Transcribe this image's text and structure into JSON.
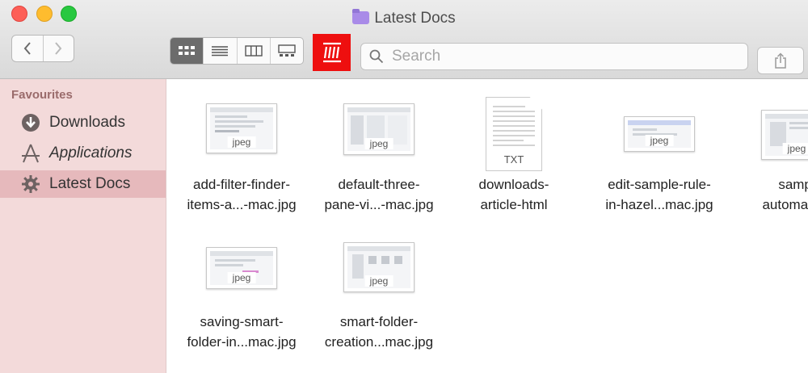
{
  "window": {
    "title": "Latest Docs"
  },
  "toolbar": {
    "search_placeholder": "Search",
    "back_icon": "chevron-left-icon",
    "forward_icon": "chevron-right-icon",
    "views": [
      "icon-view",
      "list-view",
      "column-view",
      "gallery-view"
    ],
    "active_view": "icon-view",
    "hazel_color": "#ee0f0f"
  },
  "sidebar": {
    "header": "Favourites",
    "items": [
      {
        "label": "Downloads",
        "icon": "download-icon"
      },
      {
        "label": "Applications",
        "icon": "applications-icon"
      },
      {
        "label": "Latest Docs",
        "icon": "gear-icon",
        "selected": true
      }
    ],
    "background": "#f3dada",
    "selected_color": "#e6b9bc"
  },
  "files": [
    {
      "line1": "add-filter-finder-",
      "line2": "items-a...-mac.jpg",
      "ext": "jpeg"
    },
    {
      "line1": "default-three-",
      "line2": "pane-vi...-mac.jpg",
      "ext": "jpeg"
    },
    {
      "line1": "downloads-",
      "line2": "article-html",
      "ext": "TXT"
    },
    {
      "line1": "edit-sample-rule-",
      "line2": "in-hazel...mac.jpg",
      "ext": "jpeg"
    },
    {
      "line1": "sampl",
      "line2": "automat...n",
      "ext": "jpeg"
    },
    {
      "line1": "saving-smart-",
      "line2": "folder-in...mac.jpg",
      "ext": "jpeg"
    },
    {
      "line1": "smart-folder-",
      "line2": "creation...mac.jpg",
      "ext": "jpeg"
    }
  ]
}
